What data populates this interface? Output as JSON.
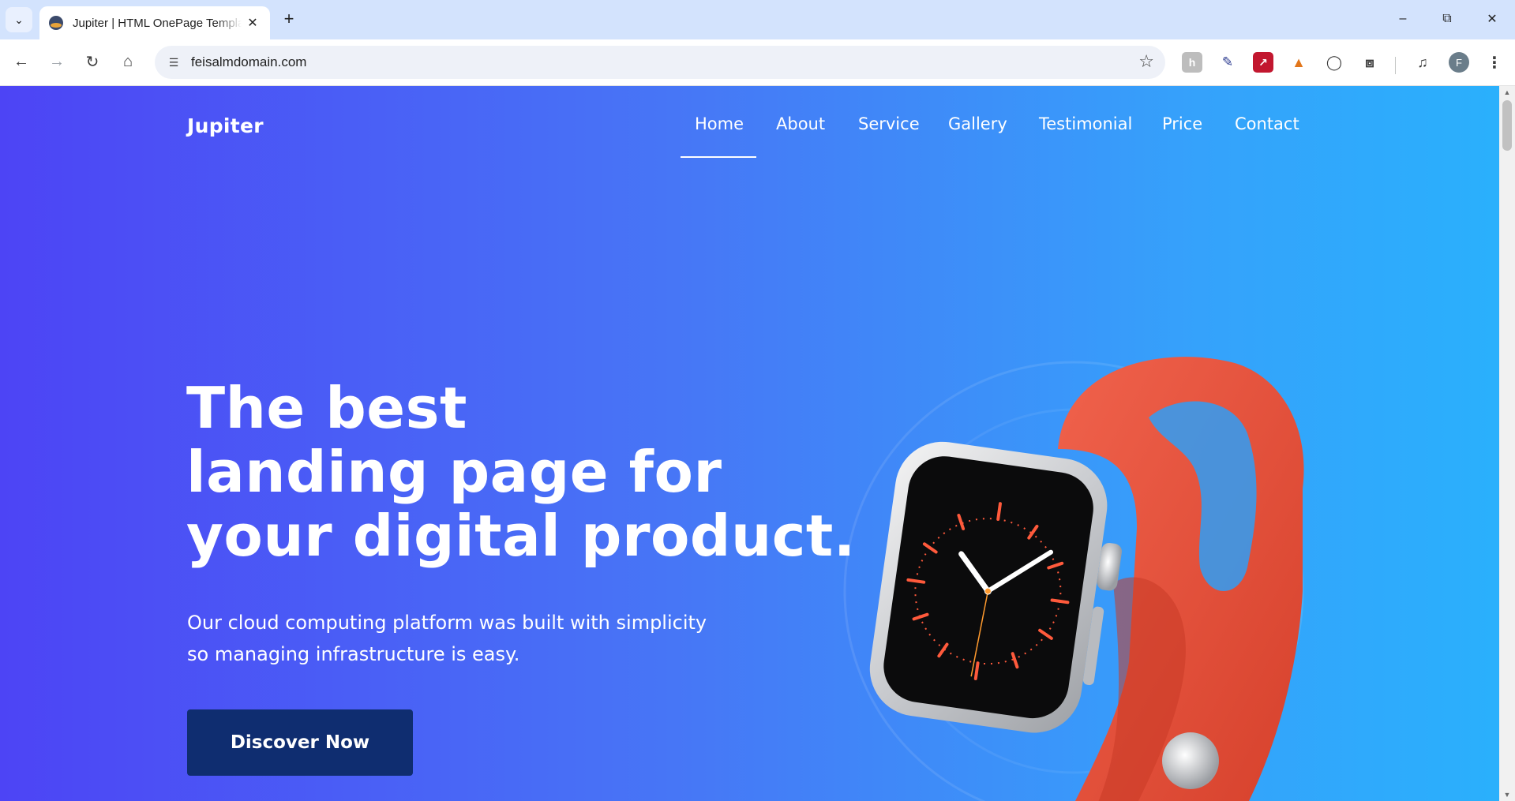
{
  "browser": {
    "tab_title": "Jupiter | HTML OnePage Template",
    "url": "feisalmdomain.com",
    "profile_initial": "F"
  },
  "site": {
    "brand": "Jupiter",
    "nav": [
      {
        "label": "Home",
        "active": true
      },
      {
        "label": "About"
      },
      {
        "label": "Service"
      },
      {
        "label": "Gallery"
      },
      {
        "label": "Testimonial"
      },
      {
        "label": "Price"
      },
      {
        "label": "Contact"
      }
    ],
    "hero": {
      "headline_lines": [
        "The best",
        "landing page for",
        "your digital product."
      ],
      "subtext_lines": [
        "Our cloud computing platform was built with simplicity",
        "so managing infrastructure is easy."
      ],
      "cta_label": "Discover Now"
    }
  },
  "colors": {
    "gradient_start": "#4d44f5",
    "gradient_end": "#2ab0fc",
    "cta_background": "#0f2d70",
    "watch_band": "#e8503a"
  }
}
